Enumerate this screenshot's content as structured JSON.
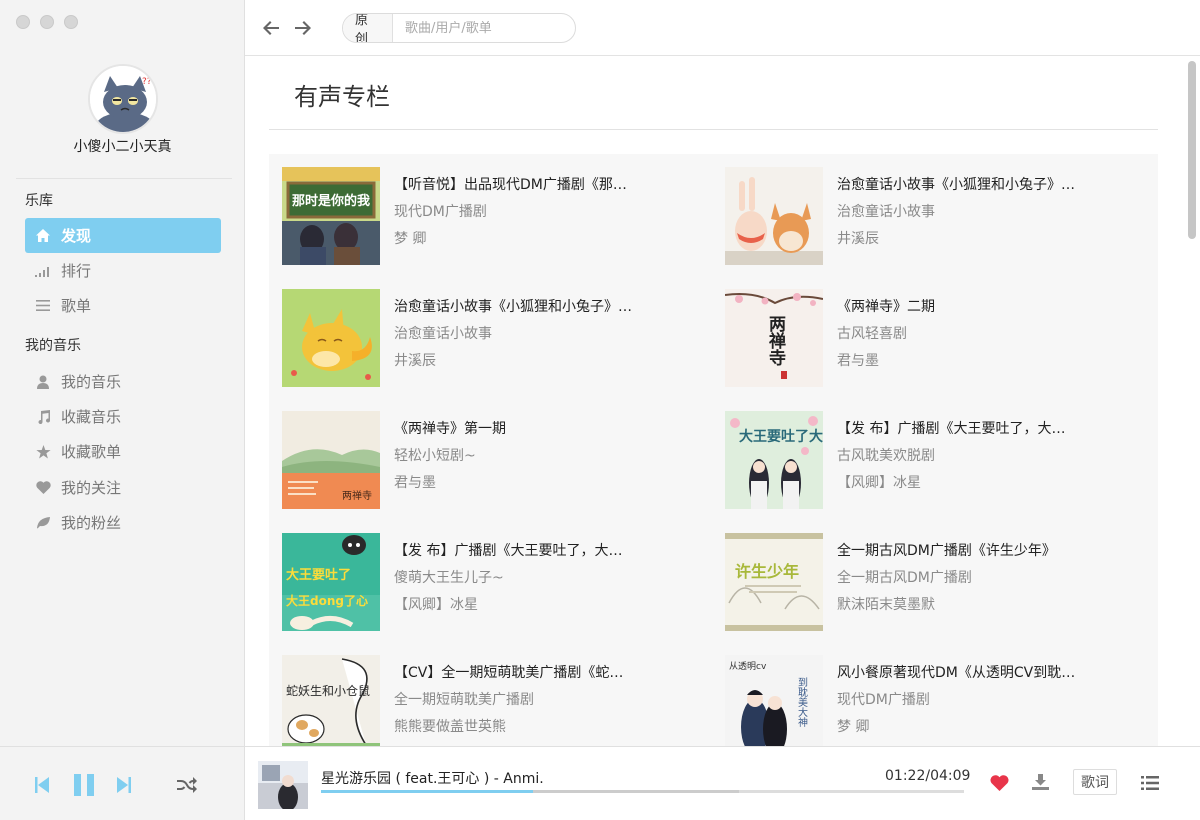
{
  "user": {
    "name": "小傻小二小天真"
  },
  "sidebar": {
    "section_library": "乐库",
    "library_items": [
      {
        "label": "发现",
        "icon": "home-icon",
        "active": true
      },
      {
        "label": "排行",
        "icon": "signal-bars-icon",
        "active": false
      },
      {
        "label": "歌单",
        "icon": "list-icon",
        "active": false
      }
    ],
    "section_my_music": "我的音乐",
    "my_items": [
      {
        "label": "我的音乐",
        "icon": "user-icon"
      },
      {
        "label": "收藏音乐",
        "icon": "music-note-icon"
      },
      {
        "label": "收藏歌单",
        "icon": "star-icon"
      },
      {
        "label": "我的关注",
        "icon": "heart-icon"
      },
      {
        "label": "我的粉丝",
        "icon": "leaf-icon"
      }
    ]
  },
  "search": {
    "tag": "原创",
    "placeholder": "歌曲/用户/歌单"
  },
  "main": {
    "title": "有声专栏",
    "cards": [
      {
        "title": "【听音悦】出品现代DM广播剧《那…",
        "category": "现代DM广播剧",
        "author": "梦 卿"
      },
      {
        "title": "治愈童话小故事《小狐狸和小兔子》…",
        "category": "治愈童话小故事",
        "author": "井溪辰"
      },
      {
        "title": "治愈童话小故事《小狐狸和小兔子》…",
        "category": "治愈童话小故事",
        "author": "井溪辰"
      },
      {
        "title": "《两禅寺》二期",
        "category": "古风轻喜剧",
        "author": "君与墨"
      },
      {
        "title": "《两禅寺》第一期",
        "category": "轻松小短剧~",
        "author": "君与墨"
      },
      {
        "title": "【发 布】广播剧《大王要吐了，大…",
        "category": "古风耽美欢脱剧",
        "author": "【风卿】冰星"
      },
      {
        "title": "【发 布】广播剧《大王要吐了，大…",
        "category": "傻萌大王生儿子~",
        "author": "【风卿】冰星"
      },
      {
        "title": "全一期古风DM广播剧《许生少年》",
        "category": "全一期古风DM广播剧",
        "author": "默沫陌末莫墨默"
      },
      {
        "title": "【CV】全一期短萌耽美广播剧《蛇…",
        "category": "全一期短萌耽美广播剧",
        "author": "熊熊要做盖世英熊"
      },
      {
        "title": "风小餐原著现代DM《从透明CV到耽…",
        "category": "现代DM广播剧",
        "author": "梦 卿"
      }
    ],
    "cover_texts": {
      "c1": "那时是你的我",
      "c4": "两禅寺",
      "c5": "两禅寺",
      "c6": "大王要吐了大王怀了蛋",
      "c7a": "大王要吐了",
      "c7b": "大王dong了心",
      "c8": "许生少年",
      "c9": "蛇妖生和小仓鼠",
      "c10a": "从透明cv",
      "c10b": "到耽美大神"
    }
  },
  "player": {
    "song": "星光游乐园 ( feat.王可心 ) - Anmi.",
    "time": "01:22/04:09",
    "progress": 0.33,
    "buffered": 0.65,
    "lyrics_label": "歌词",
    "liked": true,
    "accent": "#7fcef0",
    "heart_color": "#e8354a"
  }
}
